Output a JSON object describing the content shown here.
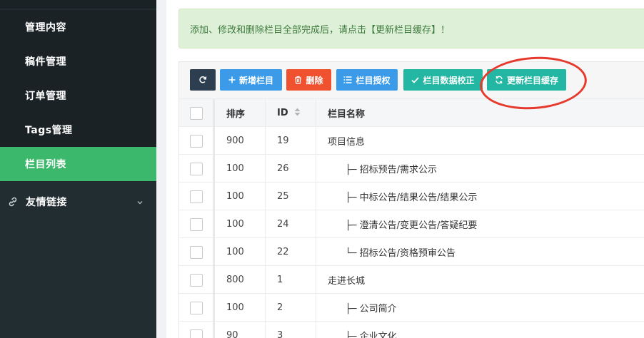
{
  "sidebar": {
    "items": [
      {
        "label": "管理内容"
      },
      {
        "label": "稿件管理"
      },
      {
        "label": "订单管理"
      },
      {
        "label": "Tags管理"
      },
      {
        "label": "栏目列表"
      },
      {
        "label": "友情链接"
      }
    ]
  },
  "alert": {
    "text": "添加、修改和删除栏目全部完成后，请点击【更新栏目缓存】！"
  },
  "toolbar": {
    "add_label": "新增栏目",
    "delete_label": "删除",
    "auth_label": "栏目授权",
    "validate_label": "栏目数据校正",
    "update_cache_label": "更新栏目缓存"
  },
  "table": {
    "headers": {
      "sort": "排序",
      "id": "ID",
      "name": "栏目名称"
    },
    "rows": [
      {
        "sort": "900",
        "id": "19",
        "name": "项目信息"
      },
      {
        "sort": "100",
        "id": "26",
        "name": "      ├─ 招标预告/需求公示"
      },
      {
        "sort": "100",
        "id": "25",
        "name": "      ├─ 中标公告/结果公告/结果公示"
      },
      {
        "sort": "100",
        "id": "24",
        "name": "      ├─ 澄清公告/变更公告/答疑纪要"
      },
      {
        "sort": "100",
        "id": "22",
        "name": "      └─ 招标公告/资格预审公告"
      },
      {
        "sort": "800",
        "id": "1",
        "name": "走进长城"
      },
      {
        "sort": "100",
        "id": "2",
        "name": "      ├─ 公司简介"
      },
      {
        "sort": "90",
        "id": "3",
        "name": "      ├─ 企业文化"
      }
    ]
  },
  "colors": {
    "sidebar_bg": "#222d32",
    "active": "#3bb86b",
    "btn_blue": "#3c9be8",
    "btn_red": "#f0522f",
    "btn_teal": "#23b7a3",
    "annotation": "#e53a2d"
  }
}
